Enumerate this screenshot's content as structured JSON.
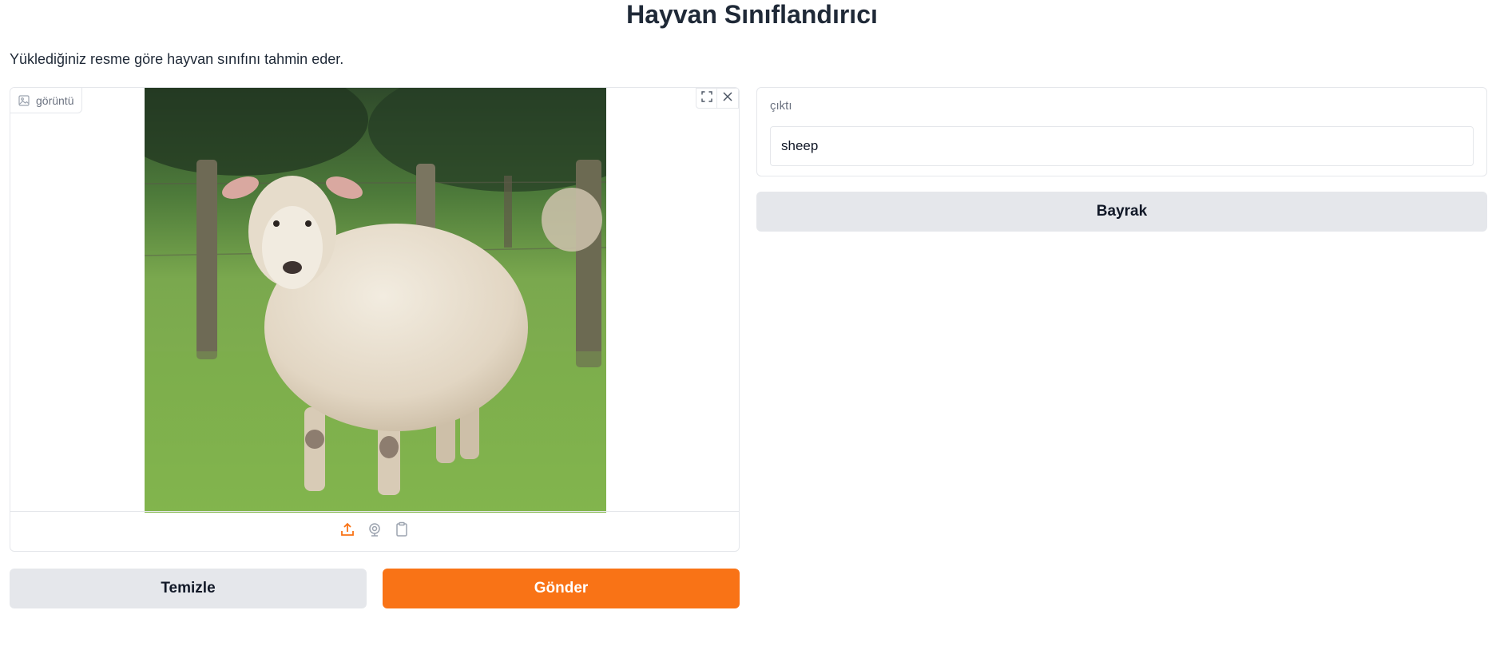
{
  "header": {
    "title": "Hayvan Sınıflandırıcı",
    "description": "Yüklediğiniz resme göre hayvan sınıfını tahmin eder."
  },
  "image_input": {
    "label": "görüntü",
    "label_icon": "image-icon",
    "tools": [
      "fullscreen-icon",
      "close-icon"
    ],
    "sources": [
      {
        "name": "upload-icon",
        "active": true
      },
      {
        "name": "webcam-icon",
        "active": false
      },
      {
        "name": "clipboard-icon",
        "active": false
      }
    ]
  },
  "buttons": {
    "clear": "Temizle",
    "submit": "Gönder",
    "flag": "Bayrak"
  },
  "output": {
    "label": "çıktı",
    "value": "sheep"
  },
  "colors": {
    "accent": "#f97316",
    "secondary_button": "#e5e7eb",
    "border": "#e5e7eb"
  }
}
